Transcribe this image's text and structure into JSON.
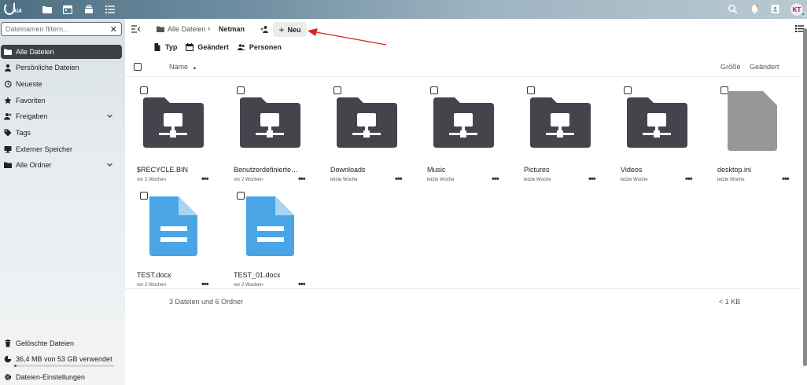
{
  "topbar": {
    "logo_text": "AIA",
    "apps": [
      "files-icon",
      "calendar-icon",
      "deck-icon",
      "tasks-icon"
    ],
    "avatar_initials": "KT"
  },
  "sidebar": {
    "filter_placeholder": "Dateinamen filtern...",
    "items": [
      {
        "label": "Alle Dateien",
        "icon": "folder-icon",
        "active": true
      },
      {
        "label": "Persönliche Dateien",
        "icon": "user-icon"
      },
      {
        "label": "Neueste",
        "icon": "history-icon"
      },
      {
        "label": "Favoriten",
        "icon": "star-icon"
      },
      {
        "label": "Freigaben",
        "icon": "share-icon",
        "expandable": true
      },
      {
        "label": "Tags",
        "icon": "tag-icon"
      },
      {
        "label": "Externer Speicher",
        "icon": "external-storage-icon"
      },
      {
        "label": "Alle Ordner",
        "icon": "folder-icon",
        "expandable": true
      }
    ],
    "footer": {
      "trash": "Gelöschte Dateien",
      "quota": "36,4 MB von 53 GB verwendet",
      "quota_fraction": 0.0007,
      "settings": "Dateien-Einstellungen"
    }
  },
  "breadcrumb": {
    "root": "Alle Dateien",
    "current": "Netman"
  },
  "toolbar": {
    "new_label": "Neu"
  },
  "filters": {
    "type": "Typ",
    "modified": "Geändert",
    "people": "Personen"
  },
  "columns": {
    "name": "Name",
    "size": "Größe",
    "modified": "Geändert"
  },
  "files": [
    {
      "name": "$RECYCLE.BIN",
      "modified": "vor 2 Wochen",
      "kind": "external-folder"
    },
    {
      "name": "Benutzerdefinierte Offi...",
      "modified": "vor 2 Wochen",
      "kind": "external-folder"
    },
    {
      "name": "Downloads",
      "modified": "letzte Woche",
      "kind": "external-folder"
    },
    {
      "name": "Music",
      "modified": "letzte Woche",
      "kind": "external-folder"
    },
    {
      "name": "Pictures",
      "modified": "letzte Woche",
      "kind": "external-folder"
    },
    {
      "name": "Videos",
      "modified": "letzte Woche",
      "kind": "external-folder"
    },
    {
      "name": "desktop.ini",
      "modified": "letzte Woche",
      "kind": "generic-file"
    },
    {
      "name": "TEST.docx",
      "modified": "vor 2 Wochen",
      "kind": "document"
    },
    {
      "name": "TEST_01.docx",
      "modified": "vor 2 Wochen",
      "kind": "document"
    }
  ],
  "summary": {
    "counts": "3 Dateien und 6 Ordner",
    "size": "< 1 KB"
  },
  "colors": {
    "folder": "#45434c",
    "document": "#49a5e6",
    "generic_file": "#979797",
    "annotation_arrow": "#e02020",
    "active_nav": "#3f3f46"
  }
}
